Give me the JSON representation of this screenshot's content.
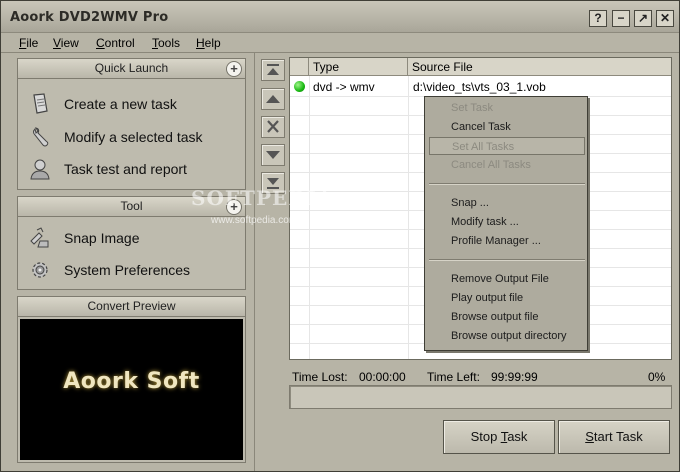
{
  "window": {
    "title": "Aoork DVD2WMV Pro"
  },
  "title_buttons": [
    {
      "icon": "help-icon",
      "glyph": "?"
    },
    {
      "icon": "minimize-icon",
      "glyph": "−"
    },
    {
      "icon": "maximize-icon",
      "glyph": "↗"
    },
    {
      "icon": "close-icon",
      "glyph": "✕"
    }
  ],
  "menu": [
    {
      "first": "F",
      "rest": "ile"
    },
    {
      "first": "V",
      "rest": "iew"
    },
    {
      "first": "C",
      "rest": "ontrol"
    },
    {
      "first": "T",
      "rest": "ools"
    },
    {
      "first": "H",
      "rest": "elp"
    }
  ],
  "quick_launch": {
    "title": "Quick Launch",
    "items": [
      {
        "label": "Create a new task",
        "icon": "document-icon"
      },
      {
        "label": "Modify a selected task",
        "icon": "wrench-icon"
      },
      {
        "label": "Task test and report",
        "icon": "user-icon"
      }
    ]
  },
  "tool": {
    "title": "Tool",
    "items": [
      {
        "label": "Snap Image",
        "icon": "camera-icon"
      },
      {
        "label": "System Preferences",
        "icon": "gear-icon"
      }
    ]
  },
  "preview": {
    "title": "Convert Preview",
    "screen_text": "Aoork Soft"
  },
  "list": {
    "columns": [
      "Type",
      "Source File"
    ],
    "rows": [
      {
        "type": "dvd -> wmv",
        "source": "d:\\video_ts\\vts_03_1.vob",
        "status_color": "#19b812"
      }
    ]
  },
  "context_menu": {
    "items": [
      {
        "label": "Set Task",
        "disabled": true
      },
      {
        "label": "Cancel Task",
        "disabled": false
      },
      {
        "label": "Set All Tasks",
        "disabled": true,
        "highlighted": true
      },
      {
        "label": "Cancel All Tasks",
        "disabled": true
      },
      {
        "label": "Snap ...",
        "disabled": false
      },
      {
        "label": "Modify task ...",
        "disabled": false
      },
      {
        "label": "Profile Manager ...",
        "disabled": false
      },
      {
        "label": "Remove Output File",
        "disabled": false
      },
      {
        "label": "Play output file",
        "disabled": false
      },
      {
        "label": "Browse output file",
        "disabled": false
      },
      {
        "label": "Browse output directory",
        "disabled": false
      }
    ]
  },
  "status": {
    "time_lost_label": "Time Lost:",
    "time_lost": "00:00:00",
    "time_left_label": "Time Left:",
    "time_left": "99:99:99",
    "percent": "0%",
    "progress": 0
  },
  "buttons": {
    "stop": {
      "first": "Stop ",
      "u": "T",
      "rest": "ask"
    },
    "start": {
      "first": "",
      "u": "S",
      "rest": "tart Task"
    }
  },
  "watermark": {
    "main": "SOFTPEDIA",
    "sub": "www.softpedia.com"
  },
  "colors": {
    "window_bg": "#b7b4a6",
    "accent_green": "#19b812"
  }
}
